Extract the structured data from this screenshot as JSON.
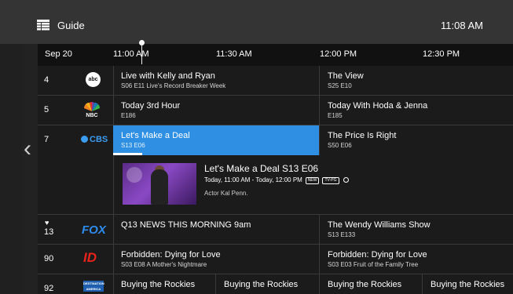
{
  "header": {
    "title": "Guide",
    "time": "11:08 AM",
    "guide_icon": "guide-grid-icon",
    "back_icon": "chevron-left-icon"
  },
  "timeline": {
    "date": "Sep 20",
    "times": [
      "11:00 AM",
      "11:30 AM",
      "12:00 PM",
      "12:30 PM"
    ]
  },
  "channels": [
    {
      "number": "4",
      "logo": "abc",
      "programs": [
        {
          "title": "Live with Kelly and Ryan",
          "subtitle": "S06 E11 Live's Record Breaker Week"
        },
        {
          "title": "The View",
          "subtitle": "S25 E10"
        }
      ]
    },
    {
      "number": "5",
      "logo": "NBC",
      "programs": [
        {
          "title": "Today 3rd Hour",
          "subtitle": "E186"
        },
        {
          "title": "Today With Hoda & Jenna",
          "subtitle": "E185"
        }
      ]
    },
    {
      "number": "7",
      "logo": "CBS",
      "programs": [
        {
          "title": "Let's Make a Deal",
          "subtitle": "S13 E06",
          "progress": 0.14
        },
        {
          "title": "The Price Is Right",
          "subtitle": "S50 E06"
        }
      ],
      "detail": {
        "title": "Let's Make a Deal S13 E06",
        "time": "Today, 11:00 AM - Today, 12:00 PM",
        "badges": [
          "NEW",
          "TV-PG"
        ],
        "cast": "Actor Kal Penn."
      }
    },
    {
      "number": "13",
      "logo": "FOX",
      "favorite": "♥",
      "programs": [
        {
          "title": "Q13 NEWS THIS MORNING 9am",
          "subtitle": ""
        },
        {
          "title": "The Wendy Williams Show",
          "subtitle": "S13 E133"
        }
      ]
    },
    {
      "number": "90",
      "logo": "ID",
      "programs": [
        {
          "title": "Forbidden: Dying for Love",
          "subtitle": "S03 E08 A Mother's Nightmare"
        },
        {
          "title": "Forbidden: Dying for Love",
          "subtitle": "S03 E03 Fruit of the Family Tree"
        }
      ]
    },
    {
      "number": "92",
      "logo": "DESTINATION AMERICA",
      "programs": [
        {
          "title": "Buying the Rockies",
          "subtitle": ""
        },
        {
          "title": "Buying the Rockies",
          "subtitle": ""
        },
        {
          "title": "Buying the Rockies",
          "subtitle": ""
        },
        {
          "title": "Buying the Rockies",
          "subtitle": ""
        }
      ]
    }
  ],
  "colors": {
    "accent": "#2f8fe3",
    "background": "#1b1b1b",
    "topbar": "#343434"
  }
}
